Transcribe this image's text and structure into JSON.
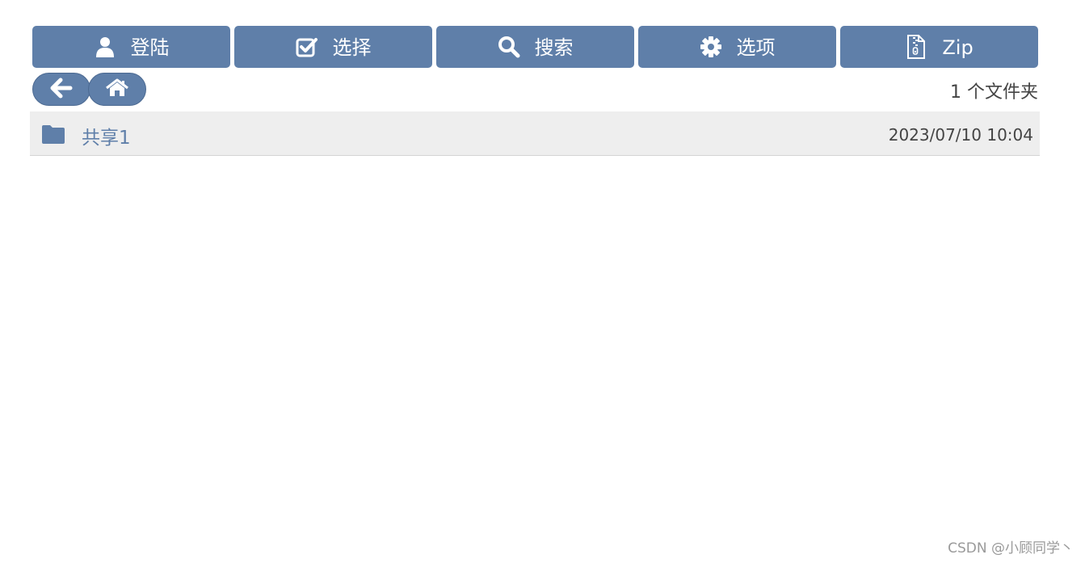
{
  "toolbar": {
    "buttons": [
      {
        "label": "登陆",
        "icon": "user-icon"
      },
      {
        "label": "选择",
        "icon": "checkbox-icon"
      },
      {
        "label": "搜索",
        "icon": "search-icon"
      },
      {
        "label": "选项",
        "icon": "gear-icon"
      },
      {
        "label": "Zip",
        "icon": "zip-file-icon"
      }
    ]
  },
  "nav": {
    "back_icon": "arrow-left-icon",
    "home_icon": "home-icon",
    "folder_count": "1 个文件夹"
  },
  "files": [
    {
      "name": "共享1",
      "date": "2023/07/10 10:04",
      "icon": "folder-icon"
    }
  ],
  "watermark": "CSDN @小顾同学丶",
  "colors": {
    "accent": "#5f7fa9",
    "row_background": "#eeeeee",
    "text": "#444444"
  }
}
